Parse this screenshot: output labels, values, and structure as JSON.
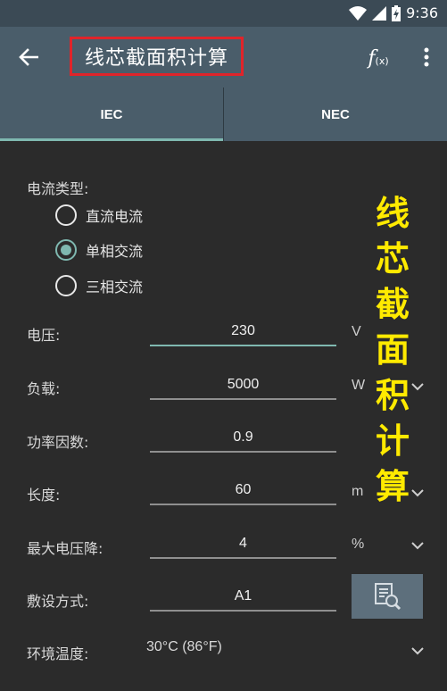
{
  "status": {
    "time": "9:36"
  },
  "appbar": {
    "title": "线芯截面积计算",
    "fx_f": "f",
    "fx_x": "(x)"
  },
  "tabs": [
    {
      "label": "IEC",
      "selected": true
    },
    {
      "label": "NEC",
      "selected": false
    }
  ],
  "form": {
    "current_type_label": "电流类型:",
    "current_types": [
      {
        "label": "直流电流",
        "checked": false
      },
      {
        "label": "单相交流",
        "checked": true
      },
      {
        "label": "三相交流",
        "checked": false
      }
    ],
    "voltage": {
      "label": "电压:",
      "value": "230",
      "unit": "V"
    },
    "load": {
      "label": "负载:",
      "value": "5000",
      "unit": "W"
    },
    "power_factor": {
      "label": "功率因数:",
      "value": "0.9"
    },
    "length": {
      "label": "长度:",
      "value": "60",
      "unit": "m"
    },
    "max_voltage_drop": {
      "label": "最大电压降:",
      "value": "4",
      "unit": "%"
    },
    "installation": {
      "label": "敷设方式:",
      "value": "A1"
    },
    "ambient_temp": {
      "label": "环境温度:",
      "value": "30°C (86°F)"
    }
  },
  "overlay": {
    "chars": [
      "线",
      "芯",
      "截",
      "面",
      "积",
      "计",
      "算"
    ]
  },
  "colors": {
    "accent": "#7fb8b0",
    "appbar": "#4a5d6a",
    "background": "#2b2b2b",
    "overlay_text": "#ffea00",
    "title_box": "#e0242a"
  }
}
